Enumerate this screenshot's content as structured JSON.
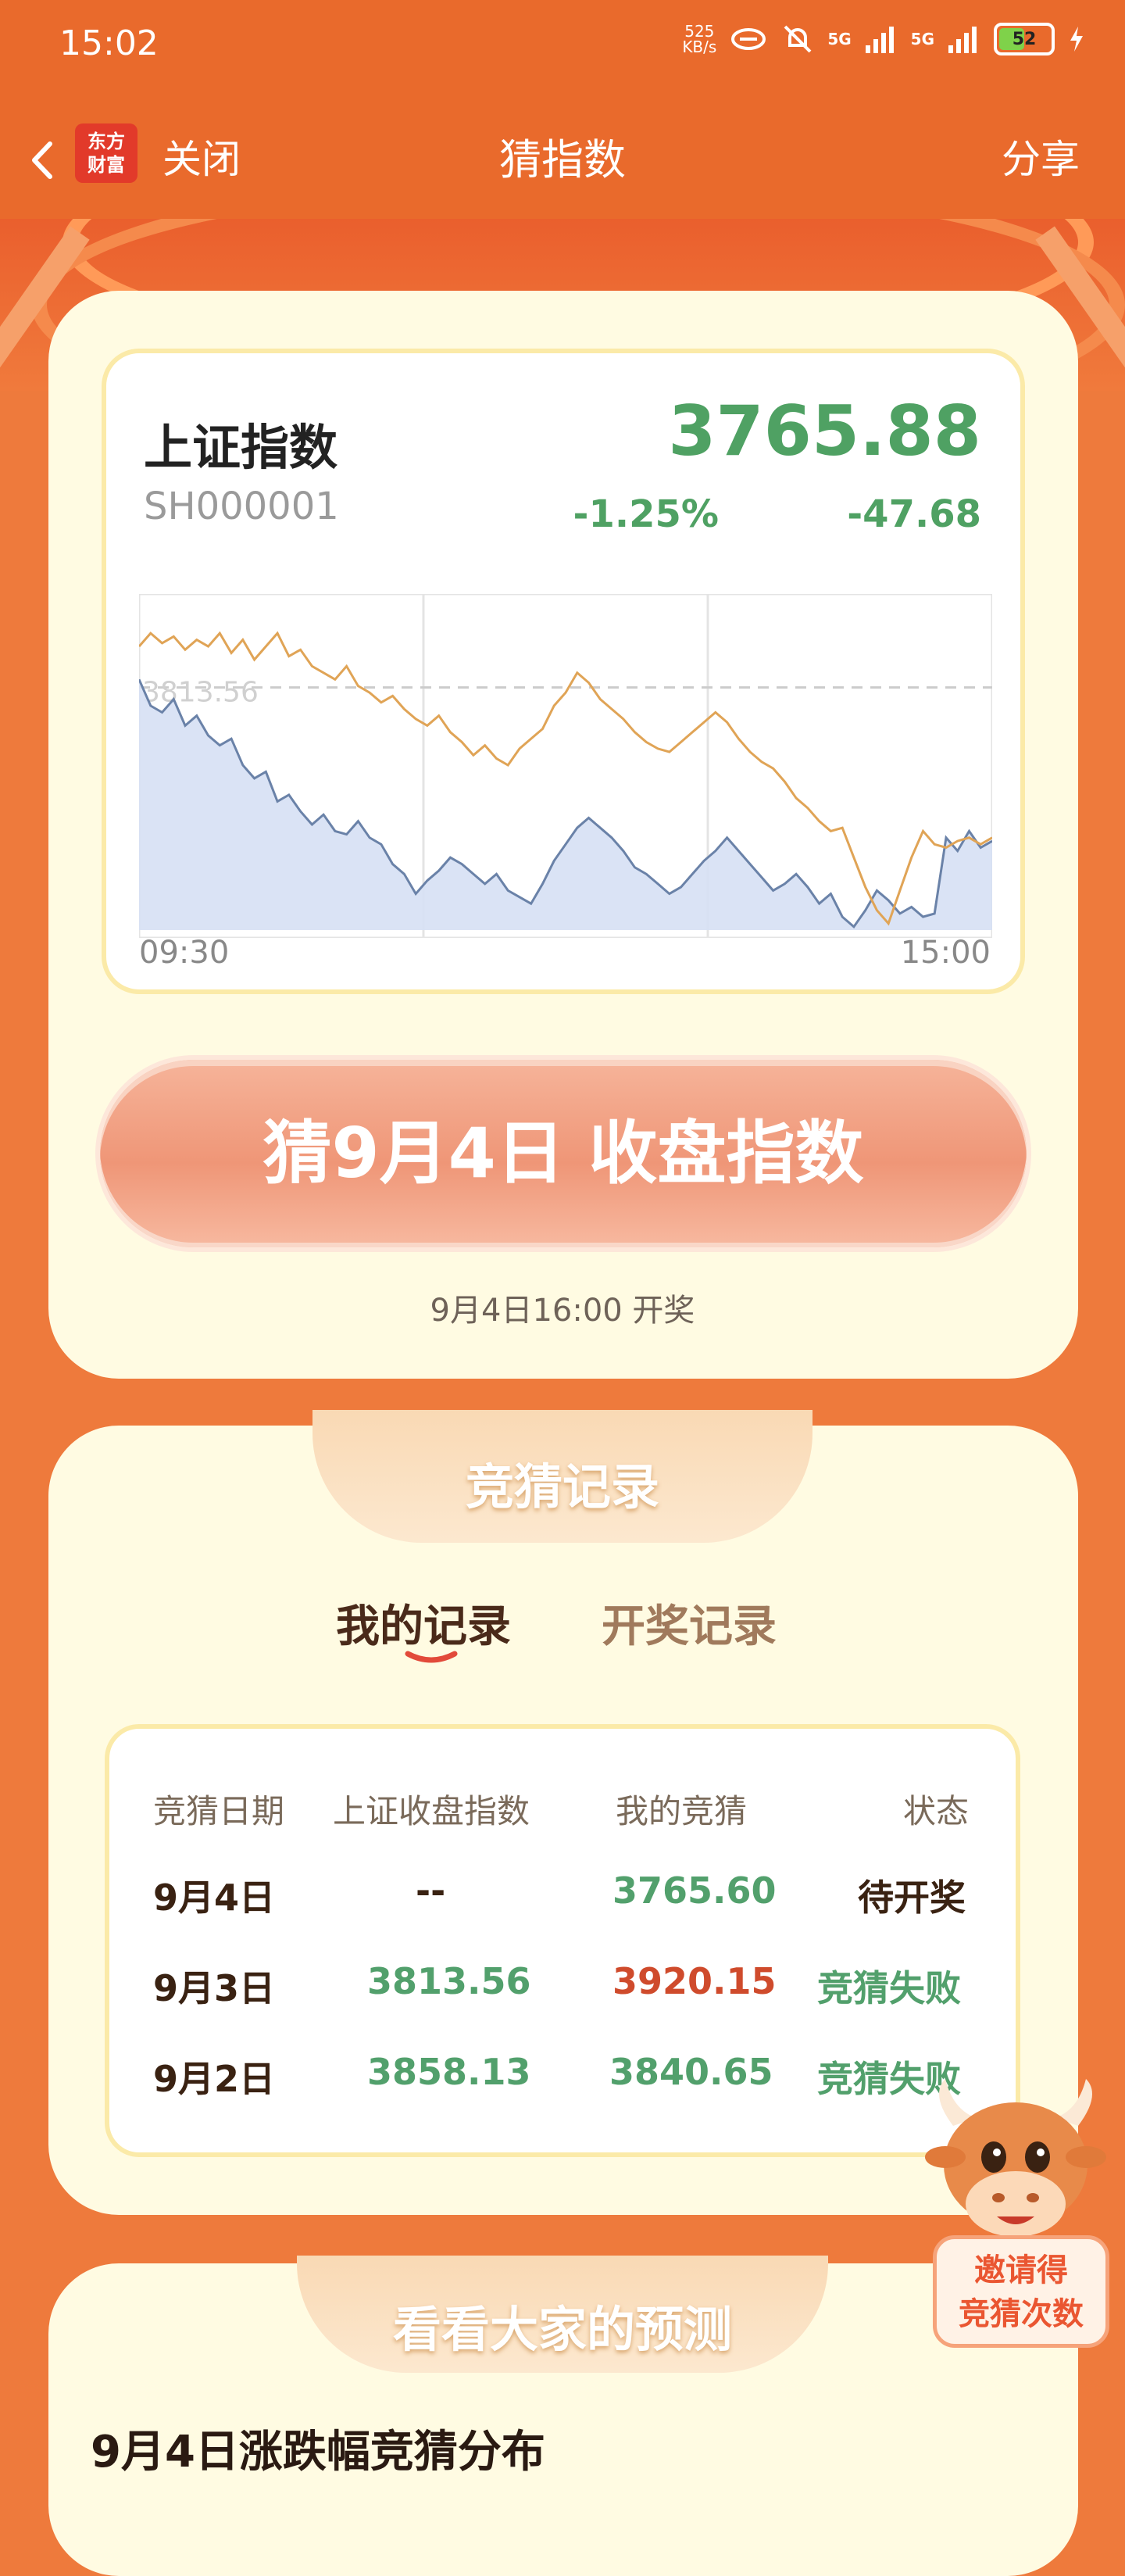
{
  "status_bar": {
    "time": "15:02",
    "net_speed_value": "525",
    "net_speed_unit": "KB/s",
    "signal1": "5G",
    "signal2": "5G",
    "battery": "52"
  },
  "nav": {
    "close": "关闭",
    "title": "猜指数",
    "share": "分享",
    "logo_line1": "东方",
    "logo_line2": "财富"
  },
  "stock": {
    "name": "上证指数",
    "code": "SH000001",
    "price": "3765.88",
    "change_pct": "-1.25%",
    "change_abs": "-47.68"
  },
  "chart_data": {
    "type": "line",
    "x_start": "09:30",
    "x_end": "15:00",
    "prev_close": 3813.56,
    "prev_close_label": "3813.56",
    "series": [
      {
        "values": [
          3816,
          3808,
          3806,
          3810,
          3802,
          3805,
          3799,
          3796,
          3798,
          3790,
          3786,
          3788,
          3779,
          3781,
          3776,
          3772,
          3775,
          3770,
          3769,
          3773,
          3768,
          3766,
          3760,
          3757,
          3751,
          3755,
          3758,
          3762,
          3760,
          3757,
          3754,
          3757,
          3752,
          3750,
          3748,
          3754,
          3761,
          3766,
          3771,
          3774,
          3771,
          3768,
          3764,
          3759,
          3757,
          3754,
          3751,
          3753,
          3757,
          3761,
          3764,
          3768,
          3764,
          3760,
          3756,
          3752,
          3754,
          3757,
          3753,
          3748,
          3751,
          3744,
          3741,
          3746,
          3752,
          3749,
          3745,
          3747,
          3744,
          3745,
          3768,
          3764,
          3770,
          3765,
          3767
        ]
      },
      {
        "values": [
          3826,
          3830,
          3827,
          3829,
          3825,
          3828,
          3826,
          3830,
          3824,
          3828,
          3822,
          3826,
          3830,
          3823,
          3825,
          3820,
          3818,
          3816,
          3820,
          3814,
          3812,
          3809,
          3811,
          3807,
          3804,
          3802,
          3805,
          3800,
          3797,
          3793,
          3796,
          3792,
          3790,
          3795,
          3798,
          3801,
          3808,
          3812,
          3818,
          3815,
          3810,
          3807,
          3804,
          3800,
          3797,
          3795,
          3794,
          3797,
          3800,
          3803,
          3806,
          3803,
          3798,
          3794,
          3791,
          3789,
          3785,
          3780,
          3777,
          3773,
          3770,
          3771,
          3762,
          3753,
          3746,
          3742,
          3752,
          3762,
          3770,
          3766,
          3765,
          3767,
          3768,
          3766,
          3768
        ]
      }
    ],
    "ylim": [
      3740,
      3840
    ],
    "colors": {
      "line1": "#6a82a8",
      "fill1": "#d6e0f4",
      "line2": "#e0a456",
      "ref": "#cccccc"
    }
  },
  "guess": {
    "button": "猜9月4日 收盘指数",
    "draw_time": "9月4日16:00 开奖"
  },
  "records": {
    "header": "竞猜记录",
    "tab_my": "我的记录",
    "tab_draw": "开奖记录",
    "columns": [
      "竞猜日期",
      "上证收盘指数",
      "我的竞猜",
      "状态"
    ],
    "rows": [
      {
        "date": "9月4日",
        "close": "--",
        "mine": "3765.60",
        "status": "待开奖"
      },
      {
        "date": "9月3日",
        "close": "3813.56",
        "mine": "3920.15",
        "status": "竞猜失败"
      },
      {
        "date": "9月2日",
        "close": "3858.13",
        "mine": "3840.65",
        "status": "竞猜失败"
      }
    ]
  },
  "invite": {
    "line1": "邀请得",
    "line2": "竞猜次数"
  },
  "predictions": {
    "header": "看看大家的预测",
    "dist_title": "9月4日涨跌幅竞猜分布"
  }
}
